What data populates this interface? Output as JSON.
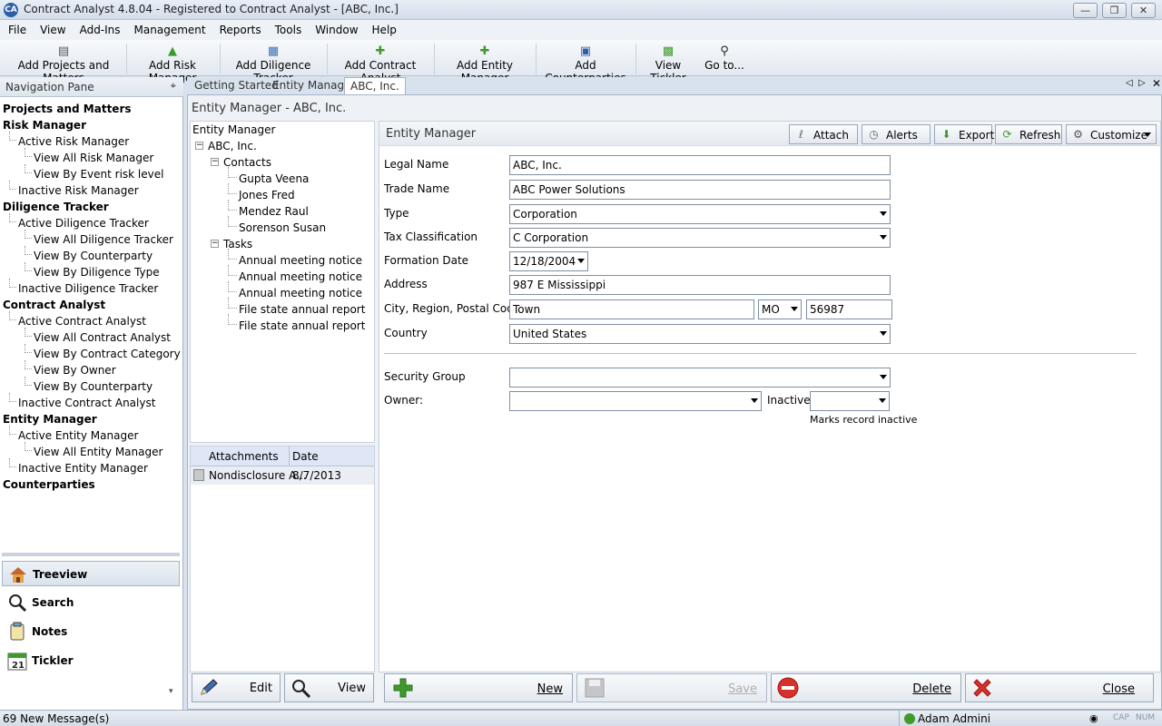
{
  "window": {
    "title": "Contract Analyst 4.8.04 - Registered to Contract Analyst - [ABC, Inc.]",
    "app_icon": "CA"
  },
  "menu": [
    "File",
    "View",
    "Add-Ins",
    "Management",
    "Reports",
    "Tools",
    "Window",
    "Help"
  ],
  "toolbar": [
    {
      "label": "Add Projects and Matters",
      "icon": "document-list-icon"
    },
    {
      "label": "Add Risk Manager",
      "icon": "risk-add-icon"
    },
    {
      "label": "Add Diligence Tracker",
      "icon": "clipboard-icon"
    },
    {
      "label": "Add Contract Analyst",
      "icon": "contract-add-icon"
    },
    {
      "label": "Add Entity Manager",
      "icon": "entity-add-icon"
    },
    {
      "label": "Add Counterparties",
      "icon": "counterparty-add-icon"
    },
    {
      "label": "View Tickler",
      "icon": "calendar-icon"
    },
    {
      "label": "Go to...",
      "icon": "search-icon"
    }
  ],
  "nav": {
    "title": "Navigation Pane",
    "items": [
      {
        "label": "Projects and Matters",
        "level": 0
      },
      {
        "label": "Risk Manager",
        "level": 0
      },
      {
        "label": "Active Risk Manager",
        "level": 1
      },
      {
        "label": "View All Risk Manager",
        "level": 2
      },
      {
        "label": "View By Event risk level",
        "level": 2
      },
      {
        "label": "Inactive Risk Manager",
        "level": 1
      },
      {
        "label": "Diligence Tracker",
        "level": 0
      },
      {
        "label": "Active Diligence Tracker",
        "level": 1
      },
      {
        "label": "View All Diligence Tracker",
        "level": 2
      },
      {
        "label": "View By Counterparty",
        "level": 2
      },
      {
        "label": "View By Diligence Type",
        "level": 2
      },
      {
        "label": "Inactive Diligence Tracker",
        "level": 1
      },
      {
        "label": "Contract Analyst",
        "level": 0
      },
      {
        "label": "Active Contract Analyst",
        "level": 1
      },
      {
        "label": "View All Contract Analyst",
        "level": 2
      },
      {
        "label": "View By Contract Category",
        "level": 2
      },
      {
        "label": "View By Owner",
        "level": 2
      },
      {
        "label": "View By Counterparty",
        "level": 2
      },
      {
        "label": "Inactive Contract Analyst",
        "level": 1
      },
      {
        "label": "Entity Manager",
        "level": 0
      },
      {
        "label": "Active Entity Manager",
        "level": 1
      },
      {
        "label": "View All Entity Manager",
        "level": 2
      },
      {
        "label": "Inactive Entity Manager",
        "level": 1
      },
      {
        "label": "Counterparties",
        "level": 0
      }
    ],
    "bottom": [
      "Treeview",
      "Search",
      "Notes",
      "Tickler"
    ],
    "tickler_day": "21"
  },
  "tabs": [
    "Getting Started",
    "Entity Manager",
    "ABC, Inc."
  ],
  "content_title": "Entity Manager - ABC, Inc.",
  "tree": {
    "root": "Entity Manager",
    "entity": "ABC, Inc.",
    "contacts_label": "Contacts",
    "contacts": [
      "Gupta Veena",
      "Jones Fred",
      "Mendez Raul",
      "Sorenson Susan"
    ],
    "tasks_label": "Tasks",
    "tasks": [
      "Annual meeting notice",
      "Annual meeting notice",
      "Annual meeting notice",
      "File state annual report",
      "File state annual report"
    ]
  },
  "attachments": {
    "col_name": "Attachments",
    "col_date": "Date",
    "rows": [
      {
        "name": "Nondisclosure A...",
        "date": "8/7/2013"
      }
    ]
  },
  "left_buttons": {
    "edit": "Edit",
    "view": "View"
  },
  "form": {
    "header": "Entity Manager",
    "actions": {
      "attach": "Attach",
      "alerts": "Alerts",
      "export": "Export",
      "refresh": "Refresh",
      "customize": "Customize"
    },
    "labels": {
      "legal_name": "Legal Name",
      "trade_name": "Trade Name",
      "type": "Type",
      "tax": "Tax Classification",
      "formation": "Formation Date",
      "address": "Address",
      "city_region": "City, Region, Postal Code",
      "country": "Country",
      "security": "Security Group",
      "owner": "Owner:",
      "inactive": "Inactive",
      "inactive_hint": "Marks record inactive"
    },
    "values": {
      "legal_name": "ABC, Inc.",
      "trade_name": "ABC Power Solutions",
      "type": "Corporation",
      "tax": "C Corporation",
      "formation": "12/18/2004",
      "address": "987 E Mississippi",
      "city": "Town",
      "region": "MO",
      "postal": "56987",
      "country": "United States",
      "security": "",
      "owner": "",
      "inactive": ""
    }
  },
  "bottom_actions": {
    "new": "New",
    "save": "Save",
    "delete": "Delete",
    "close": "Close"
  },
  "status": {
    "messages": "69 New Message(s)",
    "user": "Adam Admini",
    "caps": "CAP",
    "num": "NUM"
  },
  "colors": {
    "accent": "#2e5ea8",
    "add_green": "#3f9a2a",
    "delete_red": "#d8302a"
  }
}
